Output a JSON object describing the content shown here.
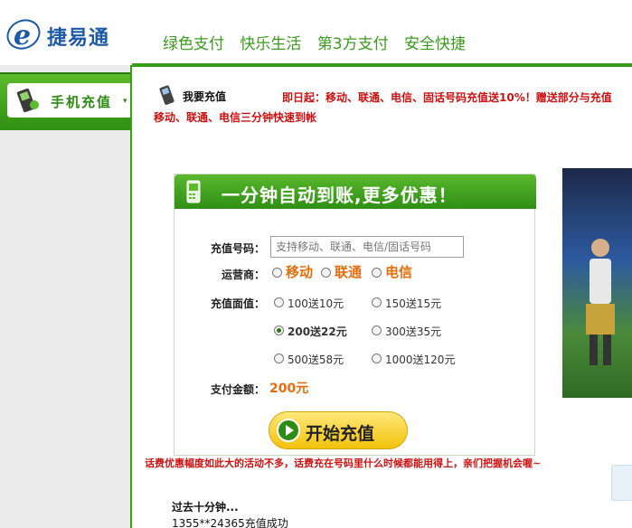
{
  "header": {
    "logo_text": "捷易通",
    "slogans": [
      "绿色支付",
      "快乐生活",
      "第3方支付",
      "安全快捷"
    ]
  },
  "sidebar": {
    "tab_label": "手机充值",
    "tab_arrow": "▾"
  },
  "main": {
    "section_title": "我要充值",
    "notice_line1": "即日起：移动、联通、电信、固话号码充值送10%！赠送部分与充值",
    "notice_line2": "移动、联通、电信三分钟快速到帐"
  },
  "form": {
    "title": "一分钟自动到账,更多优惠！",
    "phone_label": "充值号码：",
    "phone_placeholder": "支持移动、联通、电信/固话号码",
    "carrier_label": "运营商：",
    "carriers": [
      "移动",
      "联通",
      "电信"
    ],
    "amount_label": "充值面值：",
    "amounts": [
      "100送10元",
      "150送15元",
      "200送22元",
      "300送35元",
      "500送58元",
      "1000送120元"
    ],
    "selected_amount": "200送22元",
    "pay_label": "支付金额：",
    "pay_value": "200元",
    "start_button": "开始充值"
  },
  "promo": {
    "text": "话费优惠幅度如此大的活动不多，话费充在号码里什么时候都能用得上，亲们把握机会喔~"
  },
  "recent": {
    "title": "过去十分钟...",
    "item": "1355**24365充值成功"
  },
  "colors": {
    "brand_green": "#3c9a1e",
    "accent_orange": "#e46d0a",
    "notice_red": "#cc1111"
  }
}
